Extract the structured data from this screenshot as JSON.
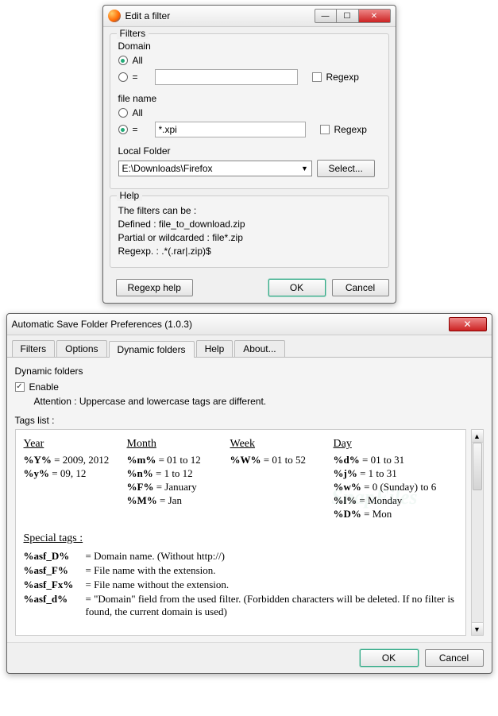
{
  "win1": {
    "title": "Edit a filter",
    "filters_legend": "Filters",
    "domain_label": "Domain",
    "all_label": "All",
    "eq_label": "=",
    "regexp_label": "Regexp",
    "filename_label": "file name",
    "filename_value": "*.xpi",
    "localfolder_label": "Local Folder",
    "localfolder_value": "E:\\Downloads\\Firefox",
    "select_label": "Select...",
    "help_legend": "Help",
    "help_lines": {
      "l1": "The filters can be :",
      "l2": "Defined : file_to_download.zip",
      "l3": "Partial or wildcarded : file*.zip",
      "l4": "Regexp. : .*(.rar|.zip)$"
    },
    "regexphelp_label": "Regexp help",
    "ok_label": "OK",
    "cancel_label": "Cancel"
  },
  "win2": {
    "title": "Automatic Save Folder Preferences (1.0.3)",
    "tabs": {
      "filters": "Filters",
      "options": "Options",
      "dynamic": "Dynamic folders",
      "help": "Help",
      "about": "About..."
    },
    "section_title": "Dynamic folders",
    "enable_label": "Enable",
    "attention": "Attention : Uppercase and lowercase tags are different.",
    "tagslist_label": "Tags list :",
    "tags": {
      "year_h": "Year",
      "year": {
        "a": "%Y% = 2009, 2012",
        "b": "%y% = 09, 12"
      },
      "month_h": "Month",
      "month": {
        "a": "%m% = 01 to 12",
        "b": "%n% = 1 to 12",
        "c": "%F% = January",
        "d": "%M% = Jan"
      },
      "week_h": "Week",
      "week": {
        "a": "%W% = 01 to 52"
      },
      "day_h": "Day",
      "day": {
        "a": "%d% = 01 to 31",
        "b": "%j% = 1 to 31",
        "c": "%w% = 0 (Sunday) to 6",
        "d": "%l% = Monday",
        "e": "%D% = Mon"
      }
    },
    "special_h": "Special tags :",
    "special": {
      "a_k": "%asf_D%",
      "a_v": "= Domain name. (Without http://)",
      "b_k": "%asf_F%",
      "b_v": "= File name with the extension.",
      "c_k": "%asf_Fx%",
      "c_v": "= File name without the extension.",
      "d_k": "%asf_d%",
      "d_v": "= \"Domain\" field from the used filter. (Forbidden characters will be deleted. If no filter is found, the current domain is used)"
    },
    "ok_label": "OK",
    "cancel_label": "Cancel"
  }
}
